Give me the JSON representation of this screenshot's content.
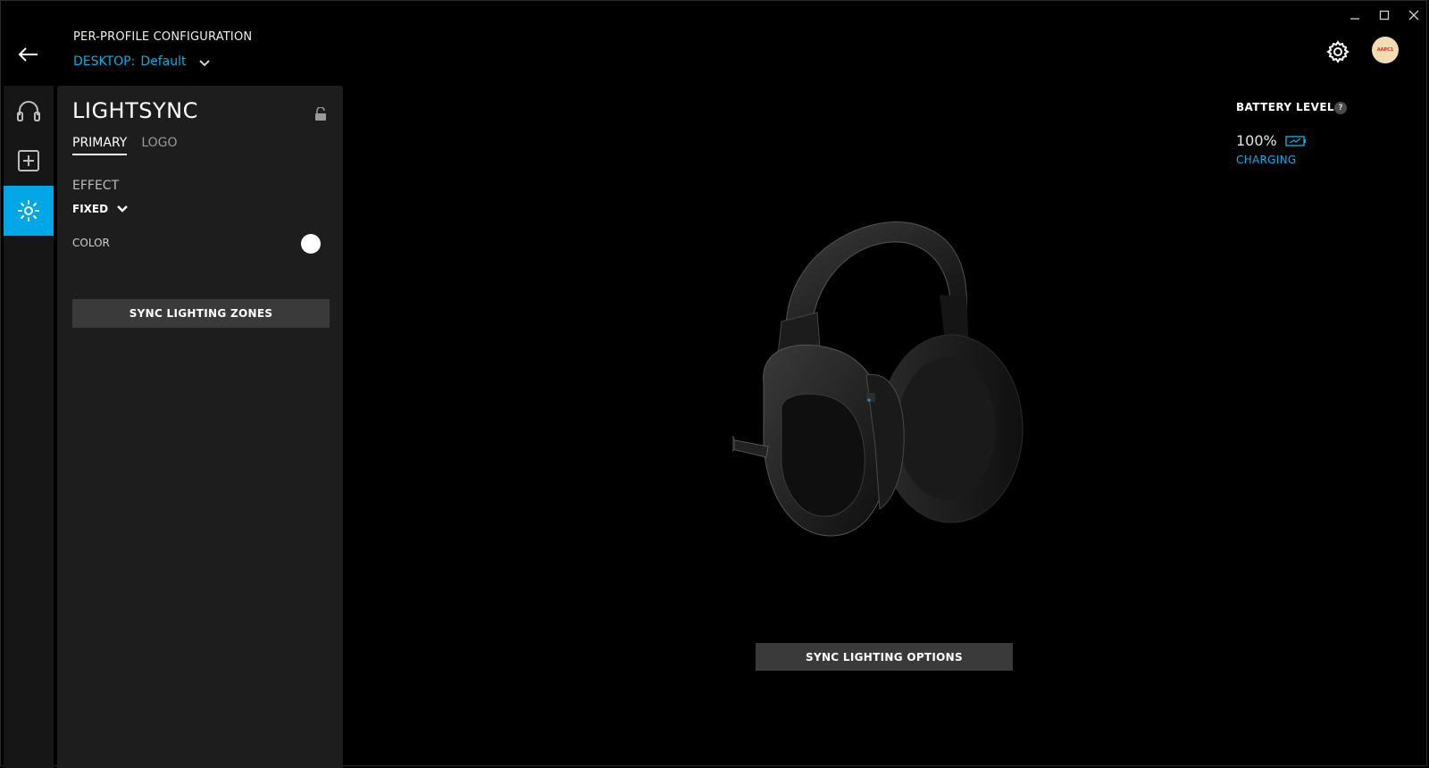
{
  "window": {
    "minimize_icon": "minimize-icon",
    "maximize_icon": "maximize-icon",
    "close_icon": "close-icon"
  },
  "header": {
    "title": "PER-PROFILE CONFIGURATION",
    "profile_prefix": "DESKTOP:",
    "profile_name": "Default",
    "avatar_text": "AAPC1"
  },
  "rail": {
    "items": [
      {
        "icon": "headset-icon"
      },
      {
        "icon": "add-assignment-icon"
      },
      {
        "icon": "lightsync-icon",
        "active": true
      }
    ]
  },
  "panel": {
    "title": "LIGHTSYNC",
    "tabs": [
      {
        "label": "PRIMARY",
        "active": true
      },
      {
        "label": "LOGO",
        "active": false
      }
    ],
    "effect_label": "EFFECT",
    "effect_value": "FIXED",
    "color_label": "COLOR",
    "color_value": "#ffffff",
    "sync_zones_label": "SYNC LIGHTING ZONES"
  },
  "battery": {
    "title": "BATTERY LEVEL",
    "help": "?",
    "percent": "100%",
    "status": "CHARGING"
  },
  "main": {
    "sync_options_label": "SYNC LIGHTING OPTIONS"
  },
  "colors": {
    "accent": "#00a6e6",
    "panel_bg": "#1d1d1d",
    "button_bg": "#3a3a3a"
  }
}
